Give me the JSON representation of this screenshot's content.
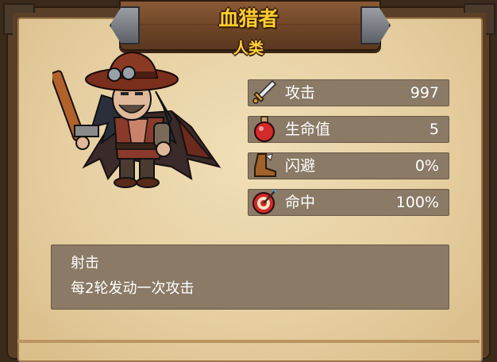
{
  "hero": {
    "name": "血猎者",
    "race": "人类"
  },
  "stats": [
    {
      "icon": "sword-icon",
      "label": "攻击",
      "value": "997"
    },
    {
      "icon": "health-potion-icon",
      "label": "生命值",
      "value": "5"
    },
    {
      "icon": "boot-icon",
      "label": "闪避",
      "value": "0%"
    },
    {
      "icon": "target-icon",
      "label": "命中",
      "value": "100%"
    }
  ],
  "skill": {
    "name": "射击",
    "description": "每2轮发动一次攻击"
  },
  "colors": {
    "title_gold": "#ffcf2e",
    "panel": "#8a7a66",
    "parchment": "#e6cfa1",
    "wood": "#6b4326"
  }
}
